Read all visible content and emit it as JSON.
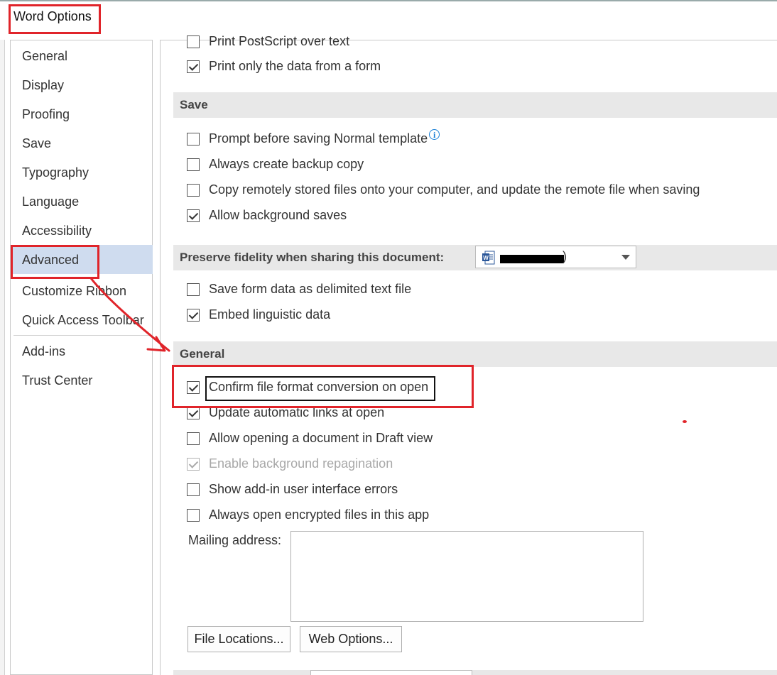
{
  "window": {
    "title": "Word Options"
  },
  "nav": {
    "items": [
      {
        "label": "General"
      },
      {
        "label": "Display"
      },
      {
        "label": "Proofing"
      },
      {
        "label": "Save"
      },
      {
        "label": "Typography"
      },
      {
        "label": "Language"
      },
      {
        "label": "Accessibility"
      },
      {
        "label": "Advanced",
        "selected": true
      },
      {
        "label": "Customize Ribbon"
      },
      {
        "label": "Quick Access Toolbar"
      },
      {
        "label": "Add-ins"
      },
      {
        "label": "Trust Center"
      }
    ]
  },
  "print_options": [
    {
      "label": "Print PostScript over text",
      "checked": false
    },
    {
      "label": "Print only the data from a form",
      "checked": true
    }
  ],
  "save_section": {
    "header": "Save",
    "options": [
      {
        "label": "Prompt before saving Normal template",
        "checked": false,
        "info_icon": true
      },
      {
        "label": "Always create backup copy",
        "checked": false
      },
      {
        "label": "Copy remotely stored files onto your computer, and update the remote file when saving",
        "checked": false
      },
      {
        "label": "Allow background saves",
        "checked": true
      }
    ]
  },
  "fidelity_section": {
    "header": "Preserve fidelity when sharing this document:",
    "dropdown_value_suffix": ")",
    "dropdown_icon": "word-doc-icon",
    "options": [
      {
        "label": "Save form data as delimited text file",
        "checked": false
      },
      {
        "label": "Embed linguistic data",
        "checked": true
      }
    ]
  },
  "general_section": {
    "header": "General",
    "options": [
      {
        "label": "Confirm file format conversion on open",
        "checked": true
      },
      {
        "label": "Update automatic links at open",
        "checked": true
      },
      {
        "label": "Allow opening a document in Draft view",
        "checked": false
      },
      {
        "label": "Enable background repagination",
        "checked": true,
        "disabled": true
      },
      {
        "label": "Show add-in user interface errors",
        "checked": false
      },
      {
        "label": "Always open encrypted files in this app",
        "checked": false
      }
    ],
    "mailing_address_label": "Mailing address:",
    "mailing_address_value": "",
    "file_locations_button": "File Locations...",
    "web_options_button": "Web Options..."
  },
  "annotation_colors": {
    "highlight": "#e0242a",
    "confirm_box": "#111111",
    "nav_selected": "#cfdcef"
  }
}
